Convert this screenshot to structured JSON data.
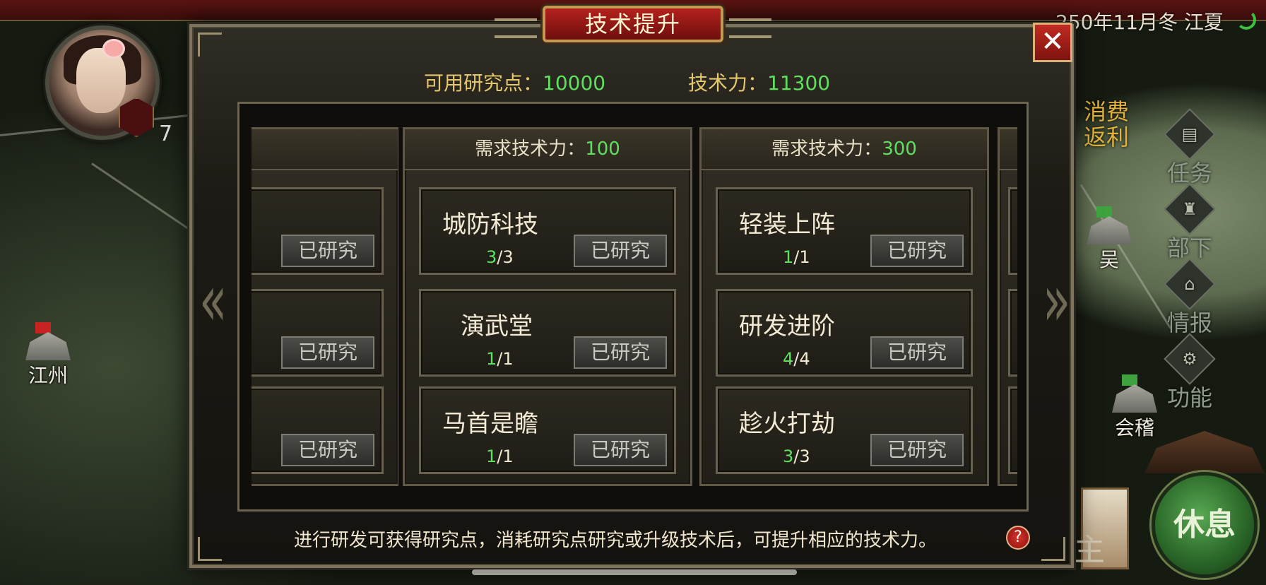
{
  "topbar": {
    "date": "250年11月冬 江夏"
  },
  "player": {
    "rank": "7"
  },
  "map": {
    "cities": [
      {
        "name": "江州"
      },
      {
        "name": "吴"
      },
      {
        "name": "会稽"
      }
    ]
  },
  "side_menu": {
    "promo": "消费\n返利",
    "items": [
      {
        "label": "任务",
        "icon": "task-icon"
      },
      {
        "label": "部下",
        "icon": "subordinate-icon"
      },
      {
        "label": "情报",
        "icon": "intel-icon"
      },
      {
        "label": "功能",
        "icon": "gear-icon"
      }
    ],
    "rest_button": "休息",
    "partial_label": "主"
  },
  "dialog": {
    "title": "技术提升",
    "close": "✕",
    "stats": {
      "points_label": "可用研究点：",
      "points_value": "10000",
      "power_label": "技术力：",
      "power_value": "11300"
    },
    "columns": [
      {
        "header_label": "需求技术力：",
        "header_value": "100",
        "techs": [
          {
            "name": "城防科技",
            "current": "3",
            "max": "/3",
            "button": "已研究"
          },
          {
            "name": "演武堂",
            "current": "1",
            "max": "/1",
            "button": "已研究"
          },
          {
            "name": "马首是瞻",
            "current": "1",
            "max": "/1",
            "button": "已研究"
          }
        ]
      },
      {
        "header_label": "需求技术力：",
        "header_value": "300",
        "techs": [
          {
            "name": "轻装上阵",
            "current": "1",
            "max": "/1",
            "button": "已研究"
          },
          {
            "name": "研发进阶",
            "current": "4",
            "max": "/4",
            "button": "已研究"
          },
          {
            "name": "趁火打劫",
            "current": "3",
            "max": "/3",
            "button": "已研究"
          }
        ]
      }
    ],
    "partial_left": {
      "buttons": [
        "已研究",
        "已研究",
        "已研究"
      ]
    },
    "footer": "进行研发可获得研究点，消耗研究点研究或升级技术后，可提升相应的技术力。",
    "help": "?"
  },
  "colors": {
    "accent_green": "#5ee05e",
    "label_gold": "#e6c86c",
    "title_red": "#b3211c"
  }
}
